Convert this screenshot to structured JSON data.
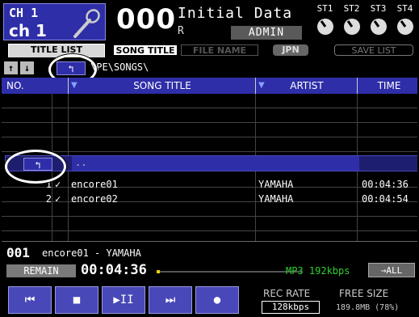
{
  "header": {
    "channel_num": "CH 1",
    "channel_name": "ch 1",
    "scene_number": "000",
    "scene_title": "Initial Data",
    "scene_flag": "R",
    "user_level": "ADMIN",
    "st_labels": [
      "ST1",
      "ST2",
      "ST3",
      "ST4"
    ]
  },
  "tabs": {
    "title_list": "TITLE LIST",
    "song_title": "SONG TITLE",
    "file_name": "FILE NAME",
    "jpn": "JPN",
    "save_list": "SAVE LIST"
  },
  "path": {
    "sort_up_icon": "↑",
    "sort_down_icon": "↓",
    "parent_dir_icon": "↰",
    "current_path": "\\PE\\SONGS\\"
  },
  "table": {
    "headers": {
      "no": "NO.",
      "song_title": "SONG TITLE",
      "artist": "ARTIST",
      "time": "TIME"
    },
    "parent_row": {
      "icon": "↰",
      "label": ".."
    },
    "songs": [
      {
        "no": "1",
        "check": "✓",
        "title": "encore01",
        "artist": "YAMAHA",
        "time": "00:04:36"
      },
      {
        "no": "2",
        "check": "✓",
        "title": "encore02",
        "artist": "YAMAHA",
        "time": "00:04:54"
      }
    ]
  },
  "now_playing": {
    "index": "001",
    "track": "encore01 - YAMAHA",
    "remain_label": "REMAIN",
    "remain_time": "00:04:36",
    "progress": 0.0,
    "format": "MP3  192kbps",
    "all_label": "→ALL"
  },
  "transport": {
    "rewind": "⏮",
    "stop": "■",
    "play_pause": "▶II",
    "forward": "⏭",
    "record": "●",
    "rec_rate_label": "REC RATE",
    "rec_rate_value": "128kbps",
    "free_size_label": "FREE SIZE",
    "free_size_value": "189.8MB (78%)"
  },
  "colors": {
    "accent_blue": "#2e2ea8",
    "progress_yellow": "#e8d000",
    "format_green": "#2fd02f"
  }
}
